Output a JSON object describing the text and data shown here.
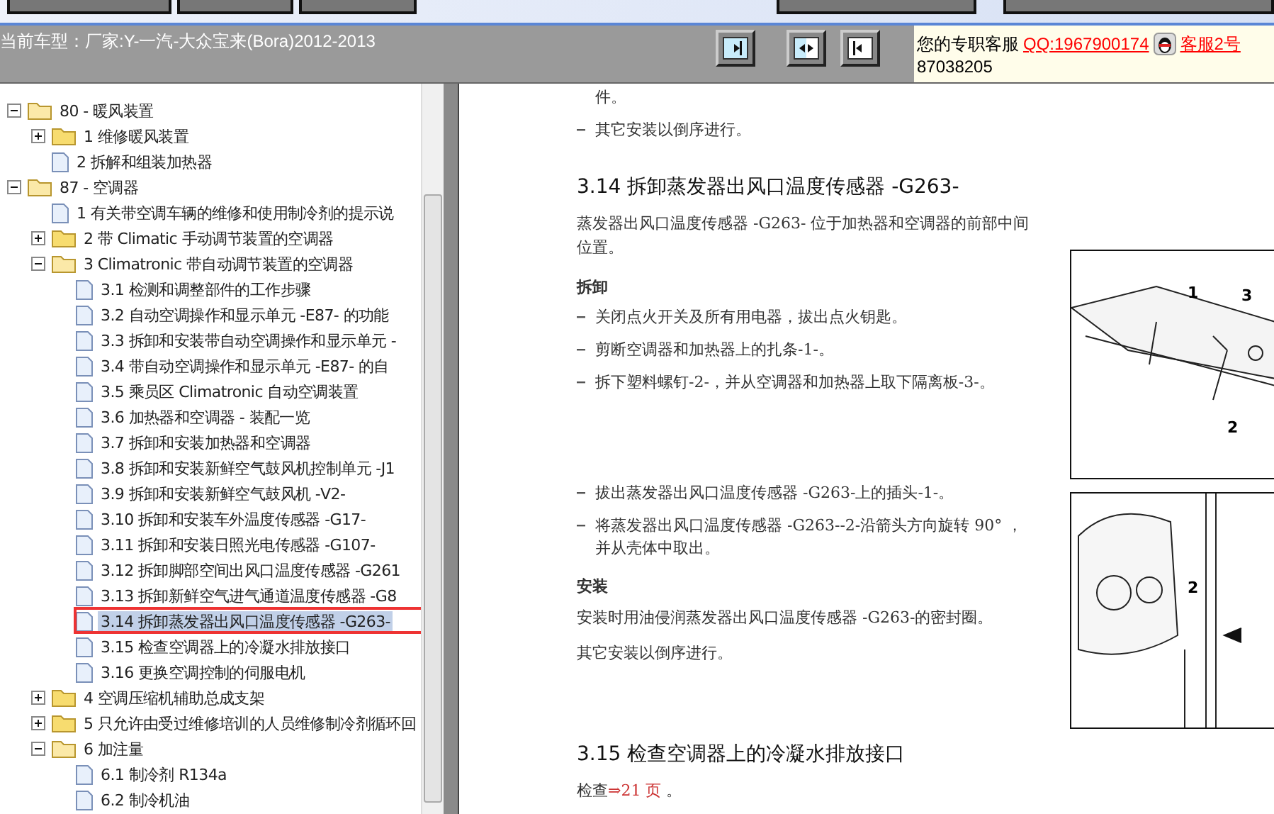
{
  "header": {
    "vehicle": "当前车型：厂家:Y-一汽-大众宝来(Bora)2012-2013",
    "view_buttons": [
      {
        "kind": "left"
      },
      {
        "kind": "both"
      },
      {
        "kind": "right"
      }
    ],
    "service": {
      "label": "您的专职客服",
      "qq": "QQ:1967900174",
      "agent": "客服2号",
      "phone": "87038205"
    }
  },
  "tree": [
    {
      "label": "80 - 暖风装置",
      "kind": "folder",
      "expanded": true,
      "selected": false,
      "children": [
        {
          "label": "1 维修暖风装置",
          "kind": "folder",
          "expanded": false,
          "selected": false
        },
        {
          "label": "2 拆解和组装加热器",
          "kind": "doc",
          "selected": false
        }
      ]
    },
    {
      "label": "87 - 空调器",
      "kind": "folder",
      "expanded": true,
      "selected": false,
      "children": [
        {
          "label": "1 有关带空调车辆的维修和使用制冷剂的提示说",
          "kind": "doc",
          "selected": false
        },
        {
          "label": "2 带 Climatic 手动调节装置的空调器",
          "kind": "folder",
          "expanded": false,
          "selected": false
        },
        {
          "label": "3 Climatronic 带自动调节装置的空调器",
          "kind": "folder",
          "expanded": true,
          "selected": false,
          "children": [
            {
              "label": "3.1 检测和调整部件的工作步骤",
              "kind": "doc",
              "selected": false
            },
            {
              "label": "3.2 自动空调操作和显示单元 -E87- 的功能",
              "kind": "doc",
              "selected": false
            },
            {
              "label": "3.3 拆卸和安装带自动空调操作和显示单元 -",
              "kind": "doc",
              "selected": false
            },
            {
              "label": "3.4 带自动空调操作和显示单元 -E87- 的自",
              "kind": "doc",
              "selected": false
            },
            {
              "label": "3.5 乘员区 Climatronic 自动空调装置",
              "kind": "doc",
              "selected": false
            },
            {
              "label": "3.6 加热器和空调器 - 装配一览",
              "kind": "doc",
              "selected": false
            },
            {
              "label": "3.7 拆卸和安装加热器和空调器",
              "kind": "doc",
              "selected": false
            },
            {
              "label": "3.8 拆卸和安装新鲜空气鼓风机控制单元 -J1",
              "kind": "doc",
              "selected": false
            },
            {
              "label": "3.9 拆卸和安装新鲜空气鼓风机 -V2-",
              "kind": "doc",
              "selected": false
            },
            {
              "label": "3.10 拆卸和安装车外温度传感器 -G17-",
              "kind": "doc",
              "selected": false
            },
            {
              "label": "3.11 拆卸和安装日照光电传感器 -G107-",
              "kind": "doc",
              "selected": false
            },
            {
              "label": "3.12 拆卸脚部空间出风口温度传感器 -G261",
              "kind": "doc",
              "selected": false
            },
            {
              "label": "3.13 拆卸新鲜空气进气通道温度传感器 -G8",
              "kind": "doc",
              "selected": false
            },
            {
              "label": "3.14 拆卸蒸发器出风口温度传感器 -G263-",
              "kind": "doc",
              "selected": true
            },
            {
              "label": "3.15 检查空调器上的冷凝水排放接口",
              "kind": "doc",
              "selected": false
            },
            {
              "label": "3.16 更换空调控制的伺服电机",
              "kind": "doc",
              "selected": false
            }
          ]
        },
        {
          "label": "4 空调压缩机辅助总成支架",
          "kind": "folder",
          "expanded": false,
          "selected": false
        },
        {
          "label": "5 只允许由受过维修培训的人员维修制冷剂循环回",
          "kind": "folder",
          "expanded": false,
          "selected": false
        },
        {
          "label": "6 加注量",
          "kind": "folder",
          "expanded": true,
          "selected": false,
          "children": [
            {
              "label": "6.1 制冷剂 R134a",
              "kind": "doc",
              "selected": false
            },
            {
              "label": "6.2 制冷机油",
              "kind": "doc",
              "selected": false
            }
          ]
        }
      ]
    }
  ],
  "document": {
    "blocks": [
      {
        "kind": "cont",
        "text": "件。"
      },
      {
        "kind": "bullet",
        "text": "其它安装以倒序进行。"
      },
      {
        "kind": "heading",
        "text": "3.14  拆卸蒸发器出风口温度传感器 -G263-"
      },
      {
        "kind": "para",
        "text": "蒸发器出风口温度传感器 -G263- 位于加热器和空调器的前部中间位置。"
      },
      {
        "kind": "sub",
        "text": "拆卸"
      },
      {
        "kind": "bullet",
        "text": "关闭点火开关及所有用电器，拔出点火钥匙。"
      },
      {
        "kind": "bullet",
        "text": "剪断空调器和加热器上的扎条-1-。"
      },
      {
        "kind": "bullet",
        "text": "拆下塑料螺钉-2-，并从空调器和加热器上取下隔离板-3-。"
      },
      {
        "kind": "spacer"
      },
      {
        "kind": "bullet",
        "text": "拔出蒸发器出风口温度传感器 -G263-上的插头-1-。"
      },
      {
        "kind": "bullet",
        "text": "将蒸发器出风口温度传感器 -G263--2-沿箭头方向旋转 90° ，并从壳体中取出。"
      },
      {
        "kind": "sub",
        "text": "安装"
      },
      {
        "kind": "para",
        "text": "安装时用油侵润蒸发器出风口温度传感器 -G263-的密封圈。"
      },
      {
        "kind": "para",
        "text": "其它安装以倒序进行。"
      },
      {
        "kind": "bigspacer"
      },
      {
        "kind": "heading",
        "text": "3.15  检查空调器上的冷凝水排放接口"
      },
      {
        "kind": "link",
        "text": "检查",
        "link": "⇒21 页",
        "after": "。"
      }
    ],
    "figures": [
      {
        "callouts": [
          "1",
          "3",
          "2"
        ]
      },
      {
        "callouts": [
          "2"
        ]
      }
    ]
  }
}
